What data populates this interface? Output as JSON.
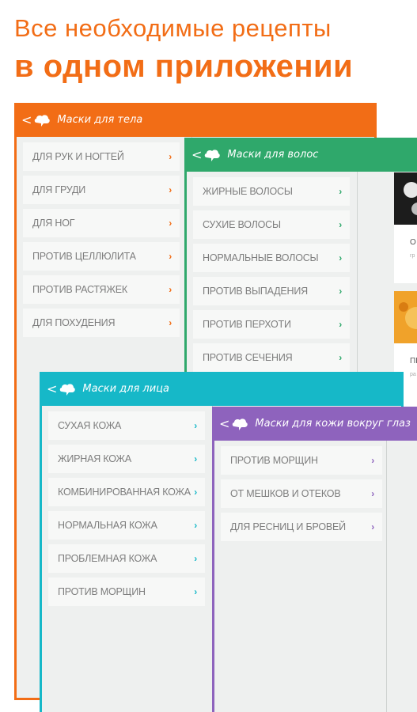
{
  "promo": {
    "line1": "Все необходимые рецепты",
    "line2": "в одном приложении"
  },
  "colors": {
    "accent_orange": "#f26d16",
    "accent_green": "#2fa86b",
    "accent_cyan": "#16b8c8",
    "accent_purple": "#8e63bd"
  },
  "panels": {
    "body": {
      "title": "Маски для тела",
      "items": [
        {
          "label": "ДЛЯ РУК И НОГТЕЙ"
        },
        {
          "label": "ДЛЯ ГРУДИ"
        },
        {
          "label": "ДЛЯ НОГ"
        },
        {
          "label": "ПРОТИВ ЦЕЛЛЮЛИТА"
        },
        {
          "label": "ПРОТИВ РАСТЯЖЕК"
        },
        {
          "label": "ДЛЯ ПОХУДЕНИЯ"
        }
      ]
    },
    "hair": {
      "title": "Маски для волос",
      "items": [
        {
          "label": "ЖИРНЫЕ ВОЛОСЫ"
        },
        {
          "label": "СУХИЕ ВОЛОСЫ"
        },
        {
          "label": "НОРМАЛЬНЫЕ ВОЛОСЫ"
        },
        {
          "label": "ПРОТИВ ВЫПАДЕНИЯ"
        },
        {
          "label": "ПРОТИВ ПЕРХОТИ"
        },
        {
          "label": "ПРОТИВ СЕЧЕНИЯ"
        }
      ],
      "cards": [
        {
          "caption": "О",
          "sub": "гр"
        },
        {
          "caption": "ПЕ",
          "sub": "ра"
        }
      ]
    },
    "face": {
      "title": "Маски для лица",
      "items": [
        {
          "label": "СУХАЯ КОЖА"
        },
        {
          "label": "ЖИРНАЯ КОЖА"
        },
        {
          "label": "КОМБИНИРОВАННАЯ КОЖА"
        },
        {
          "label": "НОРМАЛЬНАЯ КОЖА"
        },
        {
          "label": "ПРОБЛЕМНАЯ КОЖА"
        },
        {
          "label": "ПРОТИВ МОРЩИН"
        }
      ]
    },
    "eyes": {
      "title": "Маски для кожи вокруг глаз",
      "items": [
        {
          "label": "ПРОТИВ МОРЩИН"
        },
        {
          "label": "ОТ МЕШКОВ И ОТЕКОВ"
        },
        {
          "label": "ДЛЯ РЕСНИЦ И БРОВЕЙ"
        }
      ]
    }
  },
  "icons": {
    "back": "chevron-left-icon",
    "logo": "app-logo-icon",
    "item_arrow": "chevron-right-icon"
  }
}
